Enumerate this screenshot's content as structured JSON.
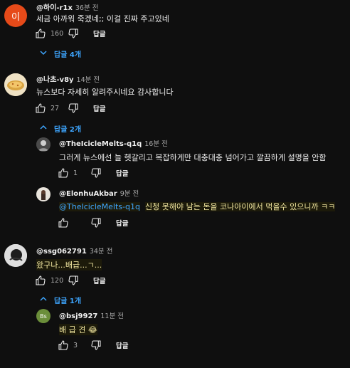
{
  "comments": [
    {
      "author": "@하이-r1x",
      "time": "36분 전",
      "avatar_letter": "이",
      "avatar_color": "#e64a19",
      "text": "세금 아까워 죽겠네;; 이걸 진짜 주고있네",
      "likes": "160",
      "reply_label": "답글",
      "replies_toggle": "답글 4개"
    },
    {
      "author": "@나초-v8y",
      "time": "14분 전",
      "text": "뉴스보다 자세히 알려주시네요 감사합니다",
      "likes": "27",
      "reply_label": "답글",
      "replies_toggle": "답글 2개",
      "replies": [
        {
          "author": "@TheIcicleMelts-q1q",
          "time": "16분 전",
          "text": "그러게 뉴스에선 늘 헷갈리고 복잡하게만 대충대충 넘어가고 깔끔하게 설명을 안함",
          "likes": "1",
          "reply_label": "답글"
        },
        {
          "author": "@ElonhuAkbar",
          "time": "9분 전",
          "mention": "@TheIcicleMelts-q1q",
          "text": "신청 못해야 남는 돈을 코나아이에서 먹을수 있으니까 ㅋㅋ",
          "likes": "",
          "reply_label": "답글"
        }
      ]
    },
    {
      "author": "@ssg062791",
      "time": "34분 전",
      "text": "왔구나...배급...ㄱ...",
      "likes": "120",
      "reply_label": "답글",
      "replies_toggle": "답글 1개",
      "replies": [
        {
          "author": "@bsj9927",
          "time": "11분 전",
          "avatar_letter": "Bs",
          "avatar_color": "#6b8e3a",
          "text": "배 급 견",
          "emoji": "😂",
          "likes": "3",
          "reply_label": "답글"
        }
      ]
    }
  ],
  "colors": {
    "link": "#3ea6ff",
    "background": "#0f0f0f",
    "secondary_text": "#aaaaaa"
  },
  "icons": [
    "thumb-up-icon",
    "thumb-down-icon",
    "chevron-down-icon"
  ]
}
